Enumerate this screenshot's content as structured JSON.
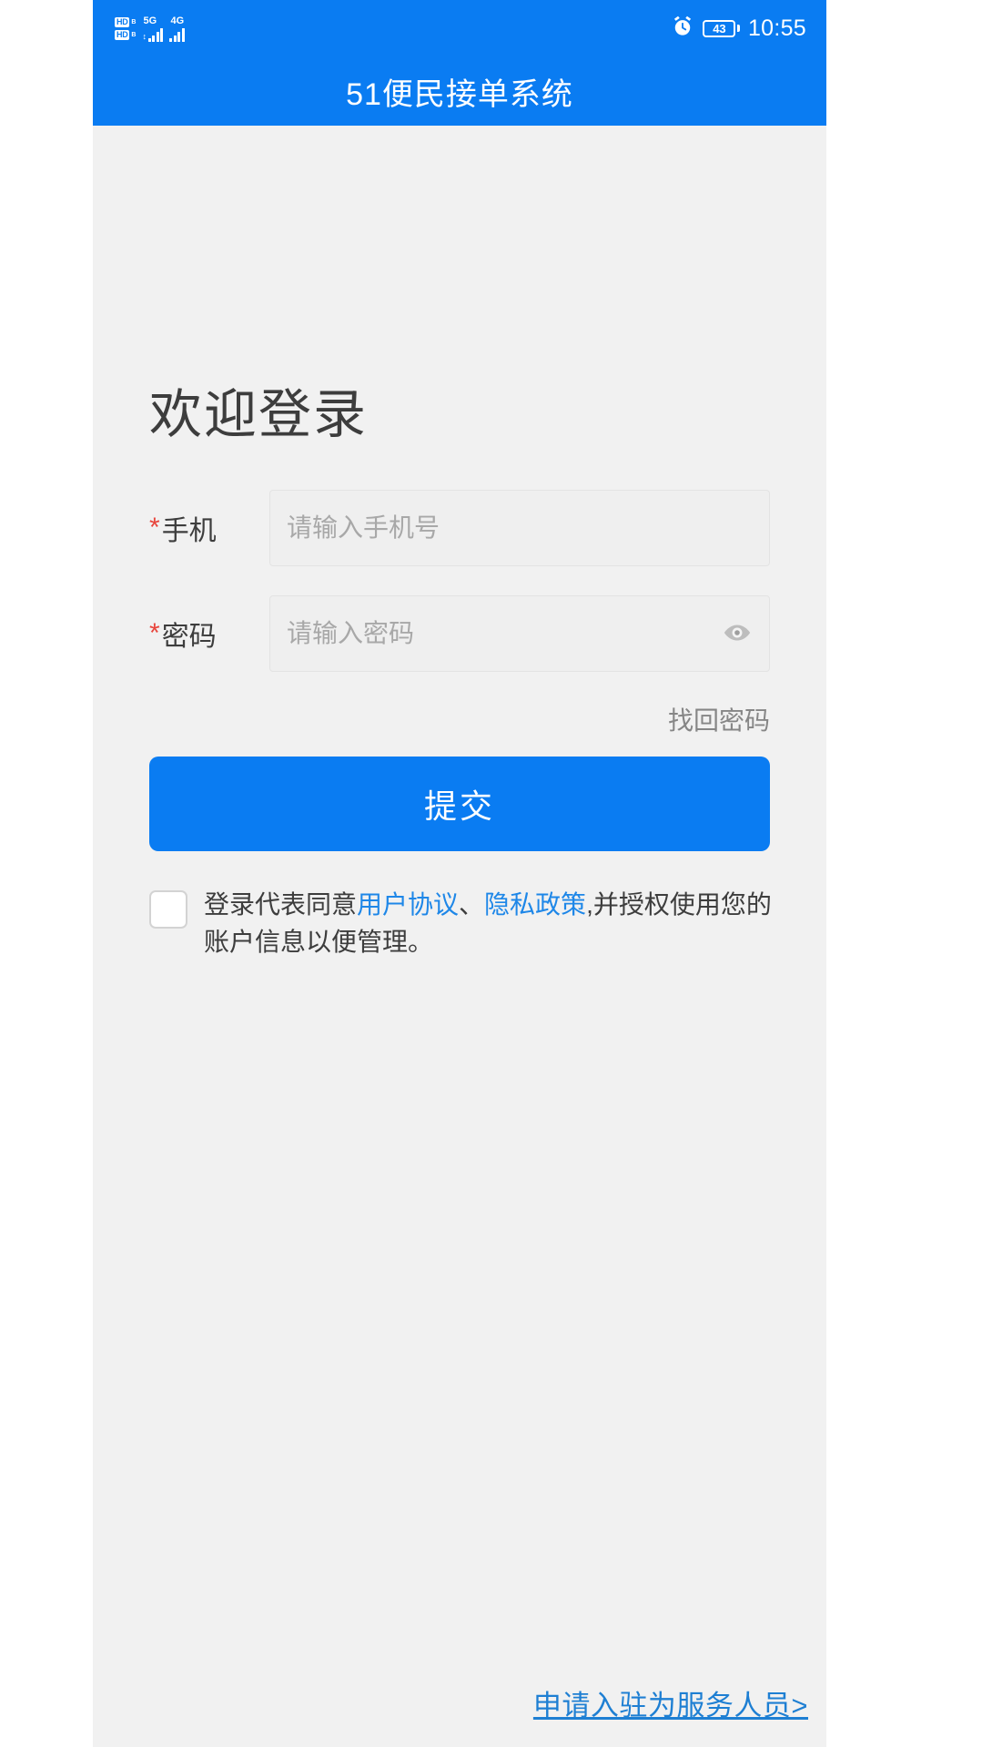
{
  "statusbar": {
    "hd_badge_1": "HD",
    "hd_sub_1": "B",
    "hd_badge_2": "HD",
    "hd_sub_2": "B",
    "sim1_network": "5G",
    "sim1_dataflow": "↕",
    "sim2_network": "4G",
    "alarm_icon": "alarm-clock-icon",
    "battery_level": "43",
    "time": "10:55"
  },
  "titlebar": {
    "title": "51便民接单系统"
  },
  "page": {
    "heading": "欢迎登录"
  },
  "form": {
    "phone": {
      "required_mark": "*",
      "label": "手机",
      "placeholder": "请输入手机号",
      "value": ""
    },
    "password": {
      "required_mark": "*",
      "label": "密码",
      "placeholder": "请输入密码",
      "value": "",
      "toggle_icon": "eye-icon"
    },
    "forgot_password": "找回密码",
    "submit_label": "提交"
  },
  "agreement": {
    "checked": false,
    "prefix": "登录代表同意",
    "link_user_agreement": "用户协议",
    "separator": "、",
    "link_privacy_policy": "隐私政策",
    "suffix": ",并授权使用您的账户信息以便管理。"
  },
  "footer": {
    "apply_link": "申请入驻为服务人员>"
  },
  "colors": {
    "brand_blue": "#0a7cf2",
    "link_blue": "#1e87e8",
    "footer_link_blue": "#1e7fd3",
    "required_red": "#e8453c",
    "body_bg": "#f1f1f1",
    "text_dark": "#3d3d3d",
    "text_muted": "#868686",
    "placeholder": "#a8a8a8"
  }
}
